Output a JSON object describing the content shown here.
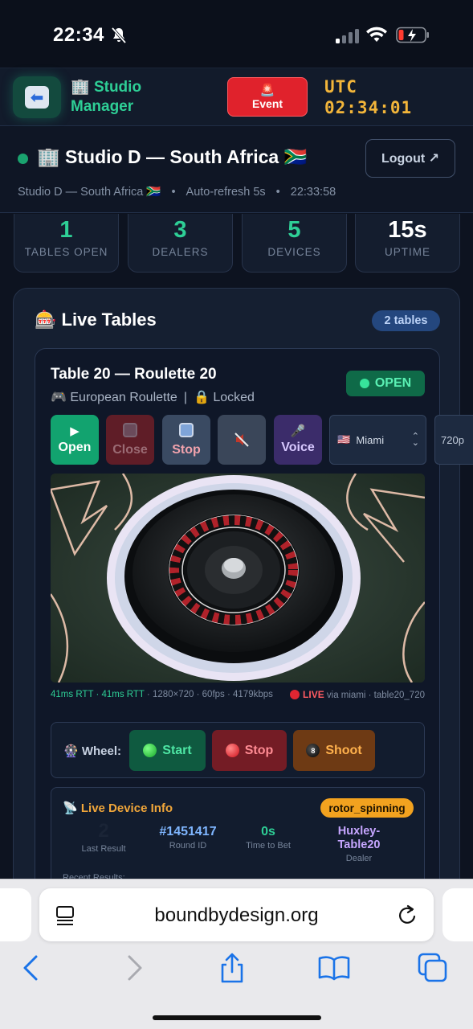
{
  "status_bar": {
    "time": "22:34"
  },
  "app_header": {
    "title_icon": "🏢",
    "title": "Studio Manager",
    "event_icon": "🚨",
    "event_label": "Event",
    "utc_label": "UTC",
    "utc_time": "02:34:01"
  },
  "studio": {
    "icon": "🏢",
    "name": "Studio D — South Africa 🇿🇦",
    "logout_label": "Logout ↗",
    "subline": [
      "Studio D — South Africa 🇿🇦",
      "Auto-refresh 5s",
      "22:33:58"
    ]
  },
  "stats": [
    {
      "value": "1",
      "label": "TABLES OPEN",
      "color": "#2ecf96"
    },
    {
      "value": "3",
      "label": "DEALERS",
      "color": "#2ecf96"
    },
    {
      "value": "5",
      "label": "DEVICES",
      "color": "#2ecf96"
    },
    {
      "value": "15s",
      "label": "UPTIME",
      "color": "#ffffff"
    }
  ],
  "live_tables": {
    "icon": "🎰",
    "title": "Live Tables",
    "count_badge": "2 tables"
  },
  "table_card": {
    "title": "Table 20 — Roulette 20",
    "game_icon": "🎮",
    "game": "European Roulette",
    "lock_icon": "🔒",
    "lock_state": "Locked",
    "status": "OPEN",
    "controls": {
      "open": "Open",
      "close": "Close",
      "stop": "Stop",
      "voice": "Voice"
    },
    "region": "Miami",
    "region_flag": "🇺🇸",
    "quality": "720p",
    "stream_meta": {
      "rtt": "41ms RTT · 41ms RTT",
      "details": " · 1280×720 · 60fps · 4179kbps",
      "live": "LIVE",
      "live_via": "via miami · table20_720"
    },
    "wheel": {
      "icon": "🎡",
      "label": "Wheel:",
      "start": "Start",
      "stop": "Stop",
      "shoot": "Shoot"
    },
    "device_info": {
      "icon": "📡",
      "title": "Live Device Info",
      "state": "rotor_spinning",
      "last_result_value": "2",
      "last_result_label": "Last Result",
      "round_id": "#1451417",
      "round_label": "Round ID",
      "time_to_bet": "0s",
      "time_label": "Time to Bet",
      "dealer": "Huxley-Table20",
      "dealer_label": "Dealer",
      "recent_label": "Recent Results:"
    }
  },
  "browser": {
    "url": "boundbydesign.org"
  }
}
